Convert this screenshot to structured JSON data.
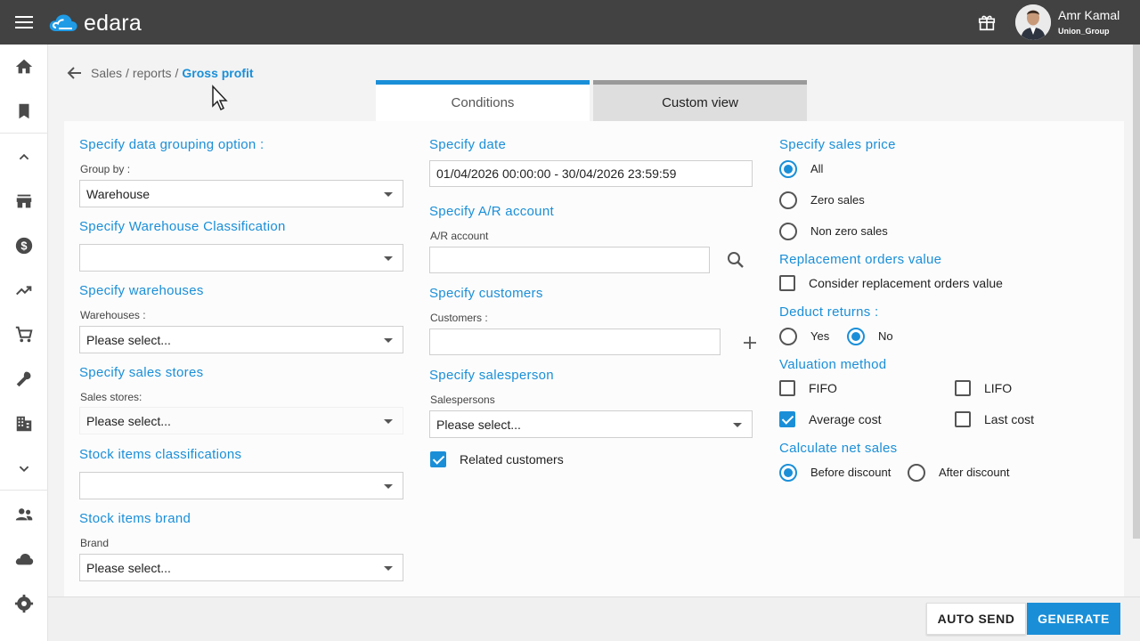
{
  "app": {
    "logo_text": "edara"
  },
  "user": {
    "name": "Amr Kamal",
    "group": "Union_Group"
  },
  "breadcrumb": {
    "items": [
      "Sales",
      "reports"
    ],
    "separator": "/",
    "current": "Gross profit"
  },
  "tabs": [
    {
      "label": "Conditions",
      "active": true
    },
    {
      "label": "Custom view",
      "active": false
    }
  ],
  "left": {
    "grouping": {
      "title": "Specify data grouping option :",
      "label": "Group by :",
      "value": "Warehouse"
    },
    "warehouse_class": {
      "title": "Specify Warehouse Classification",
      "value": ""
    },
    "warehouses": {
      "title": "Specify warehouses",
      "label": "Warehouses :",
      "value": "Please select..."
    },
    "sales_stores": {
      "title": "Specify sales stores",
      "label": "Sales stores:",
      "value": "Please select..."
    },
    "stock_class": {
      "title": "Stock items classifications",
      "value": ""
    },
    "brand": {
      "title": "Stock items brand",
      "label": "Brand",
      "value": "Please select..."
    }
  },
  "middle": {
    "date": {
      "title": "Specify date",
      "value": "01/04/2026 00:00:00 - 30/04/2026 23:59:59"
    },
    "ar_account": {
      "title": "Specify A/R account",
      "label": "A/R account",
      "value": ""
    },
    "customers": {
      "title": "Specify customers",
      "label": "Customers :",
      "value": ""
    },
    "salesperson": {
      "title": "Specify salesperson",
      "label": "Salespersons",
      "value": "Please select..."
    },
    "related_customers": {
      "label": "Related customers",
      "checked": true
    }
  },
  "right": {
    "sales_price": {
      "title": "Specify sales price",
      "options": [
        "All",
        "Zero sales",
        "Non zero sales"
      ],
      "selected": "All"
    },
    "replacement": {
      "title": "Replacement orders value",
      "label": "Consider replacement orders value",
      "checked": false
    },
    "deduct_returns": {
      "title": "Deduct returns :",
      "options": [
        "Yes",
        "No"
      ],
      "selected": "No"
    },
    "valuation": {
      "title": "Valuation method",
      "options": [
        "FIFO",
        "LIFO",
        "Average cost",
        "Last cost"
      ],
      "checked": [
        "Average cost"
      ]
    },
    "net_sales": {
      "title": "Calculate net sales",
      "options": [
        "Before discount",
        "After discount"
      ],
      "selected": "Before discount"
    }
  },
  "footer": {
    "auto_send": "AUTO SEND",
    "generate": "GENERATE"
  },
  "colors": {
    "accent": "#1a8fd8",
    "topbar": "#424242"
  }
}
